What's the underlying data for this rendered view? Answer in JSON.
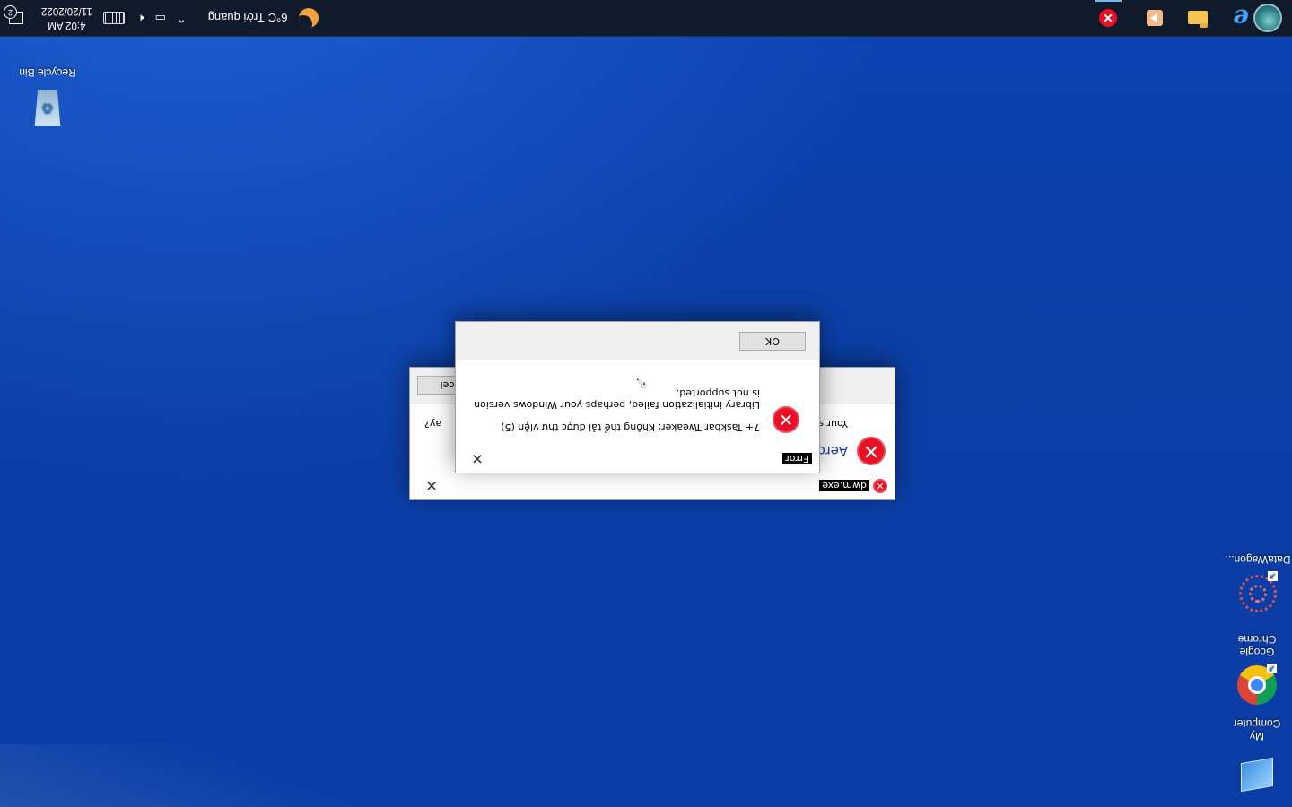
{
  "desktop": {
    "icons": [
      {
        "label": "My Computer"
      },
      {
        "label": "Google Chrome"
      },
      {
        "label": "DataWagon..."
      },
      {
        "label": "Recycle Bin"
      }
    ]
  },
  "taskbar": {
    "pinned_icons": [
      "internet-explorer-icon",
      "file-explorer-icon",
      "media-icon",
      "error-icon"
    ],
    "weather": {
      "temp": "6°C",
      "condition": "Trời quang"
    },
    "clock": {
      "time": "4:02 AM",
      "date": "11/20/2022"
    },
    "notification_count": "2"
  },
  "dialog_dwm": {
    "title": "dwm.exe",
    "heading": "Aero",
    "body": "Your s",
    "question_suffix": "ay?",
    "cancel_label": "ncel"
  },
  "dialog_error": {
    "title": "Error",
    "line1": "7+ Taskbar Tweaker: Không thể tải được thư viện (5)",
    "line2": "Library initialization failed, perhaps your Windows version is not supported.",
    "ok_label": "OK"
  },
  "colors": {
    "wallpaper": "#0b3ea3",
    "taskbar": "#0f1a2b",
    "error_red": "#e81123",
    "heading_blue": "#1c3fa8"
  }
}
